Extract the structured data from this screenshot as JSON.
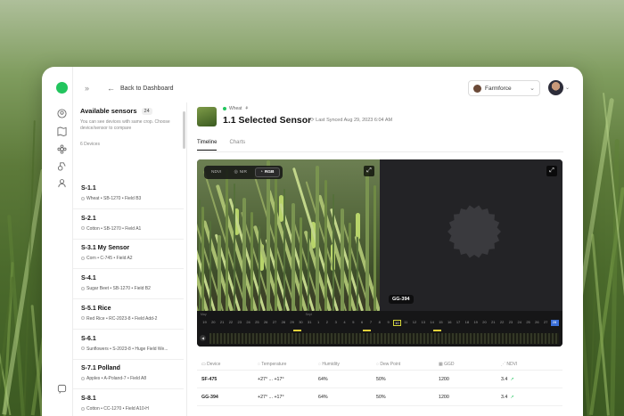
{
  "topbar": {
    "back_label": "Back to Dashboard",
    "farm_name": "Farmforce"
  },
  "sensors": {
    "title": "Available sensors",
    "count": "24",
    "description": "You can see devices with same crop. Choose device/sensor to compare",
    "device_count": "6 Devices",
    "items": [
      {
        "name": "S-1.1",
        "meta": "Wheat • SB-1270 • Field B3"
      },
      {
        "name": "S-2.1",
        "meta": "Cotton • SB-1270 • Field A1"
      },
      {
        "name": "S-3.1 My Sensor",
        "meta": "Corn • C-745 • Field A2"
      },
      {
        "name": "S-4.1",
        "meta": "Sugar Beet • SB-1270 • Field B2"
      },
      {
        "name": "S-5.1 Rice",
        "meta": "Red Rice • RC-2023-8 • Field Add-2"
      },
      {
        "name": "S-6.1",
        "meta": "Sunflowers • S-2023-8 • Huge Field We..."
      },
      {
        "name": "S-7.1 Polland",
        "meta": "Apples • A-Poland-7 • Field A8"
      },
      {
        "name": "S-8.1",
        "meta": "Cotton • CC-1270 • Field A10-H"
      }
    ]
  },
  "main": {
    "crop": "Wheat",
    "title": "1.1 Selected Sensor",
    "sync": "Last Synced Aug 29, 2023 6:04 AM",
    "tabs": [
      "Timeline",
      "Charts"
    ],
    "modes": [
      "NDVI",
      "NIR",
      "RGB"
    ],
    "right_pane_label": "GG-394",
    "timeline": {
      "months": [
        "May",
        "Sept"
      ],
      "days": [
        "19",
        "20",
        "21",
        "22",
        "23",
        "24",
        "25",
        "26",
        "27",
        "28",
        "29",
        "30",
        "31",
        "1",
        "2",
        "3",
        "4",
        "5",
        "6",
        "7",
        "8",
        "9",
        "10",
        "11",
        "12",
        "13",
        "14",
        "15",
        "16",
        "17",
        "18",
        "19",
        "20",
        "21",
        "22",
        "23",
        "24",
        "25",
        "26",
        "27",
        "28"
      ],
      "selected_index": 22
    },
    "table": {
      "headers": [
        "Device",
        "Temperature",
        "Humidity",
        "Dew Point",
        "GGD",
        "NDVI"
      ],
      "rows": [
        [
          "SF-475",
          "+27° ... +17°",
          "64%",
          "50%",
          "1200",
          "3.4"
        ],
        [
          "GG-394",
          "+27° ... +17°",
          "64%",
          "50%",
          "1200",
          "3.4"
        ]
      ]
    }
  },
  "colors": {
    "accent_green": "#22c55e",
    "timeline_selected": "#d8d83a",
    "timeline_last": "#3b6fd8"
  }
}
